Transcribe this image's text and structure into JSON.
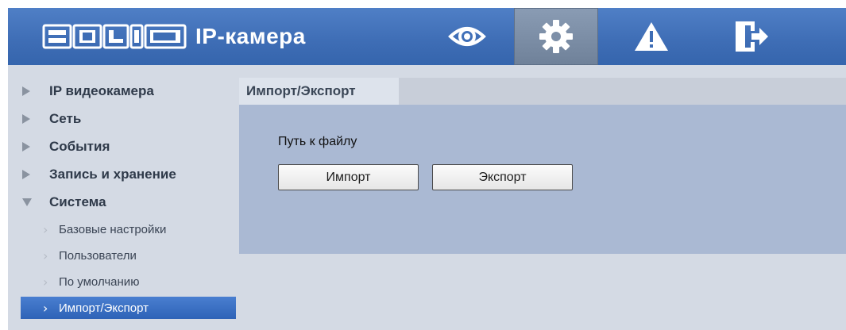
{
  "header": {
    "logo_text": "BOLID",
    "title": "IP-камера",
    "nav": [
      {
        "icon": "eye-icon",
        "name": "live-view-button"
      },
      {
        "icon": "gear-icon",
        "name": "settings-button",
        "active": true
      },
      {
        "icon": "warning-icon",
        "name": "alarm-button"
      },
      {
        "icon": "logout-icon",
        "name": "logout-button"
      }
    ]
  },
  "sidebar": {
    "items": [
      {
        "label": "IP видеокамера",
        "expanded": false
      },
      {
        "label": "Сеть",
        "expanded": false
      },
      {
        "label": "События",
        "expanded": false
      },
      {
        "label": "Запись и хранение",
        "expanded": false
      },
      {
        "label": "Система",
        "expanded": true
      }
    ],
    "sub_items": [
      {
        "label": "Базовые настройки",
        "active": false
      },
      {
        "label": "Пользователи",
        "active": false
      },
      {
        "label": "По умолчанию",
        "active": false
      },
      {
        "label": "Импорт/Экспорт",
        "active": true
      }
    ]
  },
  "main": {
    "tab_label": "Импорт/Экспорт",
    "field_label": "Путь к файлу",
    "import_label": "Импорт",
    "export_label": "Экспорт"
  },
  "colors": {
    "header": "#3e6db5",
    "active_item": "#2e63b7",
    "panel": "#aab9d3",
    "sidebar": "#d4dae4"
  }
}
